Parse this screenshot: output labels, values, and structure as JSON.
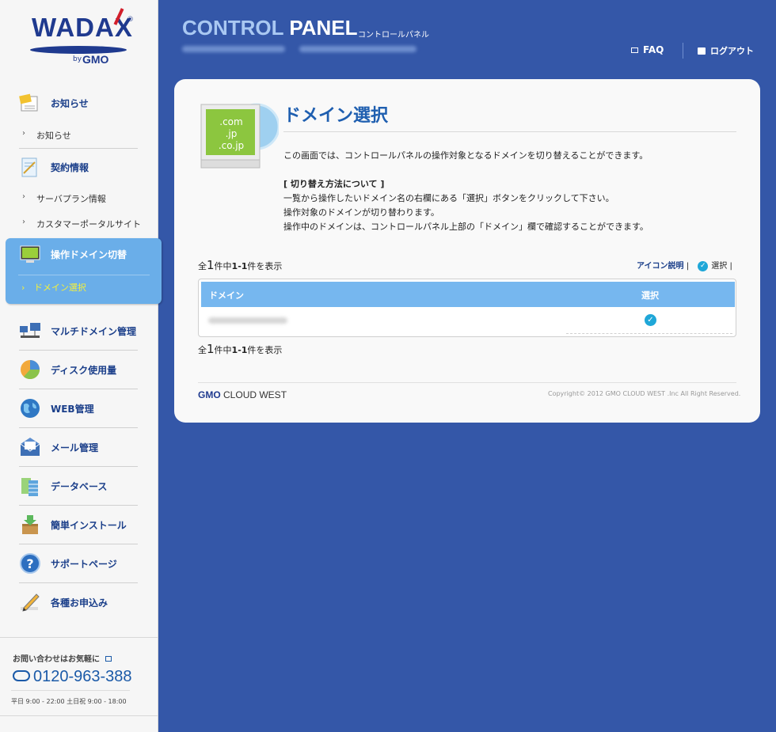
{
  "logo": {
    "brand": "WADAX",
    "registered": "®",
    "by": "by",
    "maker": "GMO"
  },
  "header": {
    "title_part1": "CONTROL",
    "title_part2": "PANEL",
    "subtitle": "コントロールパネル",
    "faq": "FAQ",
    "logout": "ログアウト"
  },
  "sidebar": {
    "news": {
      "label": "お知らせ",
      "items": [
        "お知らせ"
      ]
    },
    "contract": {
      "label": "契約情報",
      "items": [
        "サーバプラン情報",
        "カスタマーポータルサイト"
      ]
    },
    "domain_switch": {
      "label": "操作ドメイン切替",
      "items": [
        "ドメイン選択"
      ]
    },
    "menus": [
      {
        "label": "マルチドメイン管理",
        "icon": "network-icon"
      },
      {
        "label": "ディスク使用量",
        "icon": "pie-chart-icon"
      },
      {
        "label": "WEB管理",
        "icon": "globe-icon"
      },
      {
        "label": "メール管理",
        "icon": "mail-icon"
      },
      {
        "label": "データベース",
        "icon": "database-icon"
      },
      {
        "label": "簡単インストール",
        "icon": "install-icon"
      },
      {
        "label": "サポートページ",
        "icon": "help-icon"
      },
      {
        "label": "各種お申込み",
        "icon": "pencil-icon"
      }
    ],
    "arrow": "›",
    "contact": {
      "title": "お問い合わせはお気軽に",
      "phone": "0120-963-388",
      "hours": "平日 9:00 - 22:00  土日祝 9:00 - 18:00"
    }
  },
  "main": {
    "icon_text": [
      ".com",
      ".jp",
      ".co.jp"
    ],
    "title": "ドメイン選択",
    "description": "この画面では、コントロールパネルの操作対象となるドメインを切り替えることができます。",
    "howto_title": "[ 切り替え方法について ]",
    "howto_lines": [
      "一覧から操作したいドメイン名の右欄にある「選択」ボタンをクリックして下さい。",
      "操作対象のドメインが切り替わります。",
      "操作中のドメインは、コントロールパネル上部の「ドメイン」欄で確認することができます。"
    ],
    "count": {
      "prefix": "全",
      "total": "1",
      "mid": "件中",
      "range": "1-1",
      "suffix": "件を表示"
    },
    "icon_legend": {
      "link": "アイコン説明",
      "separator": "|",
      "select": "選択"
    },
    "table": {
      "col_domain": "ドメイン",
      "col_select": "選択"
    },
    "footer": {
      "logo_gmo": "GMO",
      "logo_rest": "CLOUD WEST",
      "copyright": "Copyright© 2012 GMO CLOUD WEST .Inc All Right Reserved."
    }
  },
  "colors": {
    "background": "#3457a8",
    "accent": "#1f5fb0",
    "table_header": "#76b7ef",
    "active_menu": "#6aaee9",
    "active_sub": "#f5f03a"
  }
}
